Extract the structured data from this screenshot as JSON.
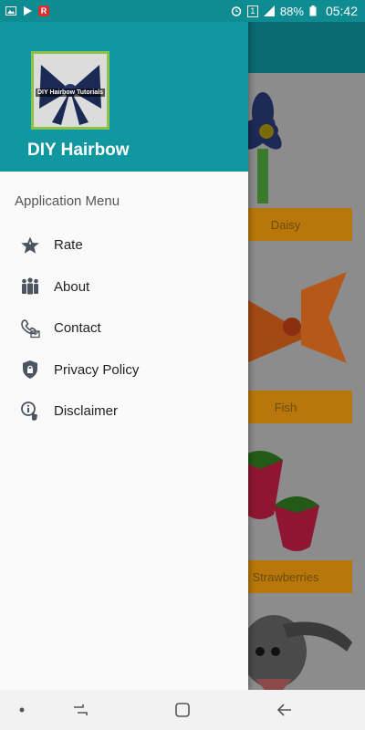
{
  "status_bar": {
    "battery": "88%",
    "time": "05:42",
    "left_icons": [
      "gallery-icon",
      "play-icon",
      "r-app-icon"
    ],
    "right_icons": [
      "alarm-icon",
      "sim-1-icon",
      "signal-icon",
      "battery-icon"
    ]
  },
  "drawer": {
    "logo_text": "DIY Hairbow Tutorials",
    "title": "DIY Hairbow",
    "menu_heading": "Application Menu",
    "items": [
      {
        "label": "Rate",
        "icon": "star-icon"
      },
      {
        "label": "About",
        "icon": "people-icon"
      },
      {
        "label": "Contact",
        "icon": "contact-icon"
      },
      {
        "label": "Privacy Policy",
        "icon": "shield-lock-icon"
      },
      {
        "label": "Disclaimer",
        "icon": "info-touch-icon"
      }
    ]
  },
  "background_list": {
    "items": [
      {
        "label": "Daisy"
      },
      {
        "label": "Fish"
      },
      {
        "label": "Strawberries"
      }
    ]
  },
  "colors": {
    "header": "#11979f",
    "status_bar": "#0f8b92",
    "card_label": "#b8770a"
  },
  "nav_bar": {
    "buttons": [
      "dot-icon",
      "recent-apps-icon",
      "home-icon",
      "back-icon"
    ]
  }
}
